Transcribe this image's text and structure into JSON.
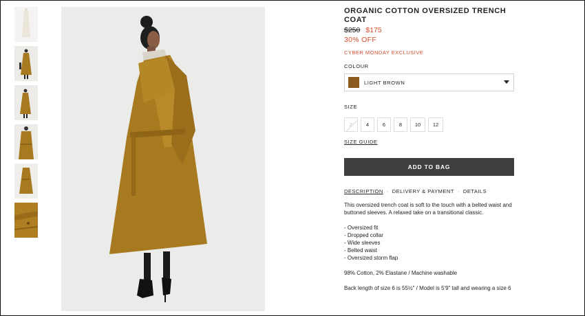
{
  "product": {
    "title": "ORGANIC COTTON OVERSIZED TRENCH COAT",
    "old_price": "$250",
    "new_price": "$175",
    "discount": "30% OFF",
    "exclusive_label": "CYBER MONDAY EXCLUSIVE"
  },
  "colour": {
    "label": "COLOUR",
    "selected": "LIGHT BROWN",
    "swatch_color": "#8a5a1e"
  },
  "size": {
    "label": "SIZE",
    "options": [
      "2",
      "4",
      "6",
      "8",
      "10",
      "12"
    ],
    "unavailable": [
      "2"
    ],
    "guide_label": "SIZE GUIDE"
  },
  "add_to_bag_label": "ADD TO BAG",
  "tabs": {
    "description": "DESCRIPTION",
    "delivery": "DELIVERY & PAYMENT",
    "details": "DETAILS",
    "separator": "·"
  },
  "description": {
    "intro": "This oversized trench coat is soft to the touch with a belted waist and buttoned sleeves. A relaxed take on a transitional classic.",
    "features": [
      "- Oversized fit",
      "- Dropped collar",
      "- Wide sleeves",
      "- Belted waist",
      "- Oversized storm flap"
    ],
    "composition": "98% Cotton, 2% Elastane / Machine washable",
    "fit_note": "Back length of size 6 is 55½\" / Model is 5'9\" tall and wearing a size 6"
  },
  "colors": {
    "sale": "#d64b2a",
    "button": "#3f3f3f",
    "coat": "#a87a1f"
  }
}
